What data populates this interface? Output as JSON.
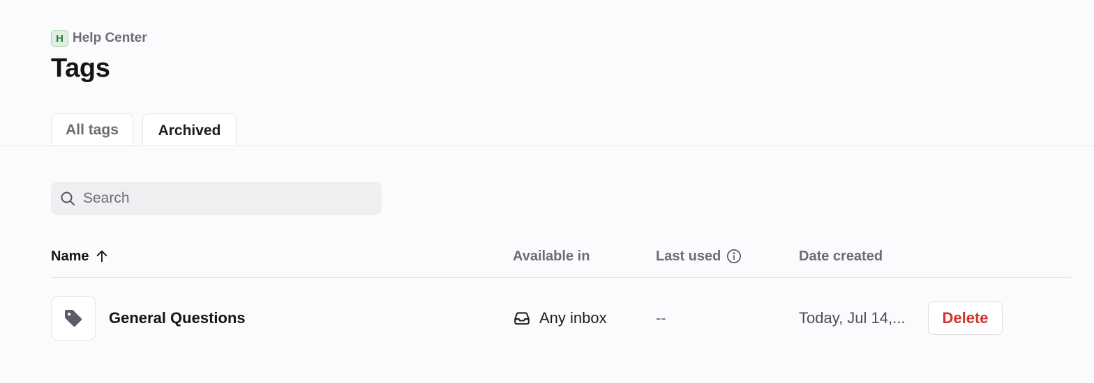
{
  "breadcrumb": {
    "workspace_initial": "H",
    "workspace_name": "Help Center"
  },
  "page": {
    "title": "Tags"
  },
  "tabs": [
    {
      "label": "All tags",
      "active": false
    },
    {
      "label": "Archived",
      "active": true
    }
  ],
  "search": {
    "placeholder": "Search",
    "value": ""
  },
  "table": {
    "columns": {
      "name": "Name",
      "available_in": "Available in",
      "last_used": "Last used",
      "date_created": "Date created"
    },
    "sort": {
      "column": "name",
      "direction": "ascending"
    },
    "rows": [
      {
        "icon": "tag-icon",
        "name": "General Questions",
        "available_in": "Any inbox",
        "available_icon": "inbox-icon",
        "last_used": "--",
        "date_created": "Today, Jul 14,...",
        "action_label": "Delete"
      }
    ]
  },
  "colors": {
    "background": "#fbfbfd",
    "danger": "#d0342c",
    "workspace_badge": "#dff0e0"
  }
}
